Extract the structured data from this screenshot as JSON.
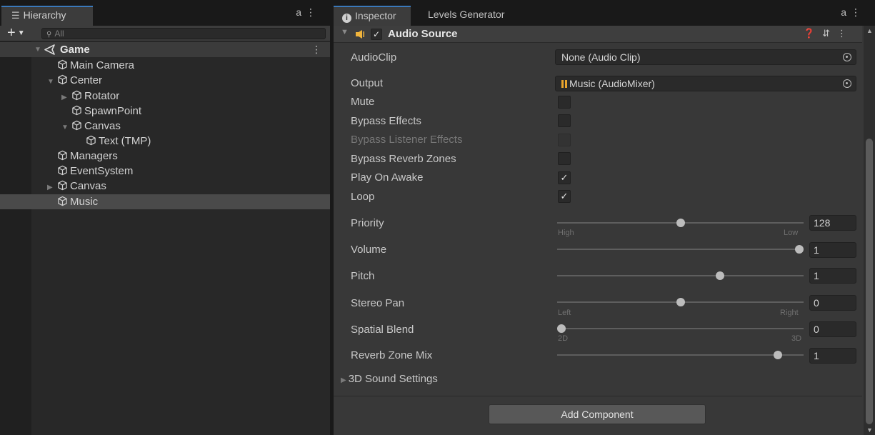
{
  "hierarchy": {
    "tab_label": "Hierarchy",
    "lock_icon": "a",
    "menu_icon": "⋮",
    "add_label": "+",
    "search_placeholder": "All",
    "scene": "Game",
    "items": [
      {
        "label": "Main Camera"
      },
      {
        "label": "Center"
      },
      {
        "label": "Rotator"
      },
      {
        "label": "SpawnPoint"
      },
      {
        "label": "Canvas"
      },
      {
        "label": "Text (TMP)"
      },
      {
        "label": "Managers"
      },
      {
        "label": "EventSystem"
      },
      {
        "label": "Canvas"
      },
      {
        "label": "Music"
      }
    ]
  },
  "inspector": {
    "tabs": [
      "Inspector",
      "Levels Generator"
    ],
    "component_title": "Audio Source",
    "component_enabled": true,
    "properties": {
      "audioclip": {
        "label": "AudioClip",
        "value": "None (Audio Clip)"
      },
      "output": {
        "label": "Output",
        "value": "Music (AudioMixer)"
      },
      "mute": {
        "label": "Mute",
        "checked": false
      },
      "bypass_effects": {
        "label": "Bypass Effects",
        "checked": false
      },
      "bypass_listener_effects": {
        "label": "Bypass Listener Effects",
        "checked": false
      },
      "bypass_reverb_zones": {
        "label": "Bypass Reverb Zones",
        "checked": false
      },
      "play_on_awake": {
        "label": "Play On Awake",
        "checked": true
      },
      "loop": {
        "label": "Loop",
        "checked": true
      },
      "priority": {
        "label": "Priority",
        "value": "128",
        "fraction": 0.5,
        "min_label": "High",
        "max_label": "Low"
      },
      "volume": {
        "label": "Volume",
        "value": "1",
        "fraction": 1.0
      },
      "pitch": {
        "label": "Pitch",
        "value": "1",
        "fraction": 0.667
      },
      "stereo_pan": {
        "label": "Stereo Pan",
        "value": "0",
        "fraction": 0.5,
        "min_label": "Left",
        "max_label": "Right"
      },
      "spatial_blend": {
        "label": "Spatial Blend",
        "value": "0",
        "fraction": 0.0,
        "min_label": "2D",
        "max_label": "3D"
      },
      "reverb_zone_mix": {
        "label": "Reverb Zone Mix",
        "value": "1",
        "fraction": 0.909
      }
    },
    "sound_settings_label": "3D Sound Settings",
    "add_component_label": "Add Component",
    "checkmark": "✓"
  },
  "colors": {
    "accent": "#3a79bb",
    "mixer_icon": "#e8a32c",
    "speaker_icon": "#f0b43c"
  }
}
